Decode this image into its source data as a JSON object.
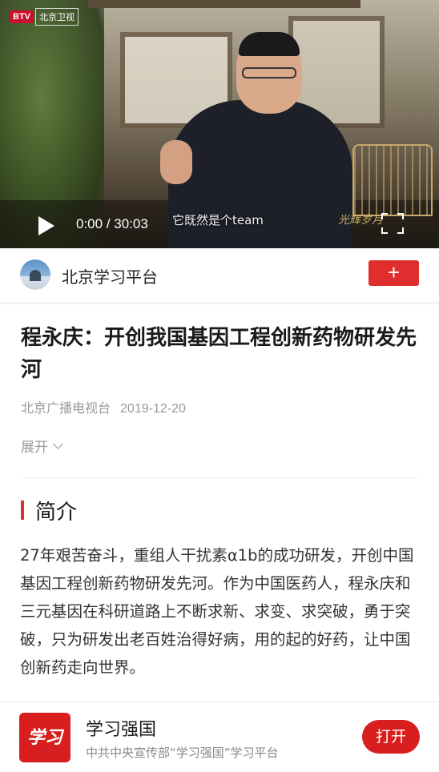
{
  "video": {
    "logo_brand": "BTV",
    "logo_channel": "北京卫视",
    "time": "0:00 / 30:03",
    "caption": "它既然是个team",
    "watermark": "光辉岁月"
  },
  "channel": {
    "name": "北京学习平台",
    "follow_label": "+",
    "accent": "#e02d2d"
  },
  "article": {
    "title": "程永庆：开创我国基因工程创新药物研发先河",
    "source": "北京广播电视台",
    "date": "2019-12-20",
    "expand_label": "展开"
  },
  "section": {
    "title": "简介",
    "body": "27年艰苦奋斗，重组人干扰素α1b的成功研发，开创中国基因工程创新药物研发先河。作为中国医药人，程永庆和三元基因在科研道路上不断求新、求变、求突破，勇于突破，只为研发出老百姓治得好病，用的起的好药，让中国创新药走向世界。"
  },
  "banner": {
    "logo_text": "学习",
    "app_name": "学习强国",
    "description": "中共中央宣传部“学习强国”学习平台",
    "open_label": "打开",
    "brand_color": "#d81e1e"
  }
}
